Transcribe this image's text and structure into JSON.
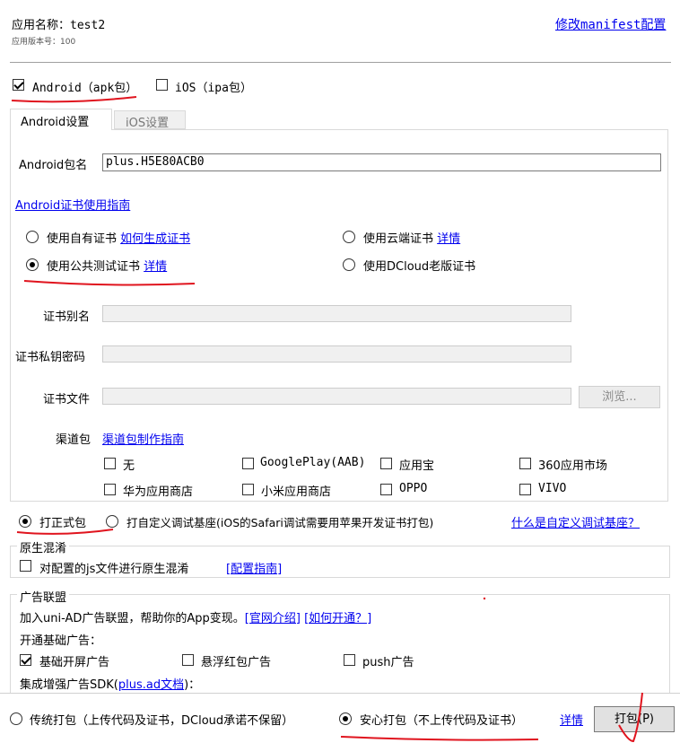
{
  "app": {
    "name_label": "应用名称：",
    "name_value": "test2",
    "version_label": "应用版本号：100",
    "modify_manifest_link": "修改manifest配置"
  },
  "platforms": {
    "android": {
      "label": "Android（apk包）",
      "checked": true
    },
    "ios": {
      "label": "iOS（ipa包）",
      "checked": false
    }
  },
  "tabs": [
    {
      "label": "Android设置",
      "active": true
    },
    {
      "label": "iOS设置",
      "active": false
    }
  ],
  "android": {
    "package_label": "Android包名",
    "package_value": "plus.H5E80ACB0",
    "cert_guide_link": "Android证书使用指南",
    "cert_options": {
      "own": {
        "label": "使用自有证书",
        "link": "如何生成证书",
        "checked": false
      },
      "cloud": {
        "label": "使用云端证书",
        "link": "详情",
        "checked": false
      },
      "public": {
        "label": "使用公共测试证书",
        "link": "详情",
        "checked": true
      },
      "dcloud_old": {
        "label": "使用DCloud老版证书",
        "checked": false
      }
    },
    "alias_label": "证书别名",
    "password_label": "证书私钥密码",
    "file_label": "证书文件",
    "browse_button": "浏览...",
    "channel_label": "渠道包",
    "channel_guide_link": "渠道包制作指南",
    "channels": [
      {
        "label": "无",
        "checked": false
      },
      {
        "label": "GooglePlay(AAB)",
        "checked": false
      },
      {
        "label": "应用宝",
        "checked": false
      },
      {
        "label": "360应用市场",
        "checked": false
      },
      {
        "label": "华为应用商店",
        "checked": false
      },
      {
        "label": "小米应用商店",
        "checked": false
      },
      {
        "label": "OPPO",
        "checked": false
      },
      {
        "label": "VIVO",
        "checked": false
      }
    ]
  },
  "build_type": {
    "formal": {
      "label": "打正式包",
      "checked": true
    },
    "custom_base": {
      "label": "打自定义调试基座(iOS的Safari调试需要用苹果开发证书打包)",
      "checked": false
    },
    "what_is_link": "什么是自定义调试基座？"
  },
  "obfuscation": {
    "title": "原生混淆",
    "option_label": "对配置的js文件进行原生混淆",
    "guide_link": "[配置指南]",
    "checked": false
  },
  "ads": {
    "title": "广告联盟",
    "intro": "加入uni-AD广告联盟，帮助你的App变现。",
    "official_link": "[官网介绍]",
    "how_link": "[如何开通？]",
    "basic_label": "开通基础广告：",
    "options": [
      {
        "label": "基础开屏广告",
        "checked": true
      },
      {
        "label": "悬浮红包广告",
        "checked": false
      },
      {
        "label": "push广告",
        "checked": false
      }
    ],
    "sdk_label_prefix": "集成增强广告SDK(",
    "sdk_link": "plus.ad文档",
    "sdk_label_suffix": ")："
  },
  "footer": {
    "traditional": {
      "label": "传统打包（上传代码及证书，DCloud承诺不保留）",
      "checked": false
    },
    "safe": {
      "label": "安心打包（不上传代码及证书）",
      "checked": true
    },
    "detail_link": "详情",
    "pack_button": "打包(P)"
  },
  "colors": {
    "annotation_red": "#e0141e",
    "link": "#0000ee",
    "tab_inactive_bg": "#f0f0f0"
  }
}
